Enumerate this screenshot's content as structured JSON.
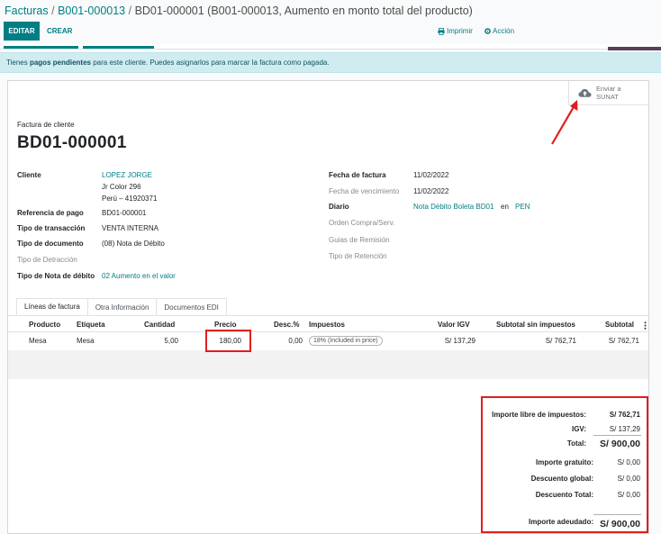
{
  "breadcrumb": {
    "item1": "Facturas",
    "sep1": " / ",
    "item2": "B001-000013",
    "sep2": " / ",
    "current": "BD01-000001 (B001-000013, Aumento en monto total del producto)"
  },
  "toolbar": {
    "edit": "EDITAR",
    "create": "CREAR",
    "print": "Imprimir",
    "action": "Acción"
  },
  "alert": {
    "prefix": "Tienes ",
    "bold": "pagos pendientes",
    "suffix": " para este cliente. Puedes asignarlos para marcar la factura como pagada."
  },
  "sunat": {
    "line1": "Enviar a",
    "line2": "SUNAT"
  },
  "invoice": {
    "subtitle": "Factura de cliente",
    "number": "BD01-000001"
  },
  "left": {
    "cliente_label": "Cliente",
    "cliente_name": "LOPEZ JORGE",
    "cliente_addr1": "Jr Color 296",
    "cliente_addr2": "Perú – 41920371",
    "ref_label": "Referencia de pago",
    "ref_value": "BD01-000001",
    "tipo_trans_label": "Tipo de transacción",
    "tipo_trans_value": "VENTA INTERNA",
    "tipo_doc_label": "Tipo de documento",
    "tipo_doc_value": "(08) Nota de Débito",
    "tipo_detr_label": "Tipo de Detracción",
    "tipo_nota_label": "Tipo de Nota de débito",
    "tipo_nota_value": "02 Aumento en el valor"
  },
  "right": {
    "fecha_label": "Fecha de factura",
    "fecha_value": "11/02/2022",
    "venc_label": "Fecha de vencimiento",
    "venc_value": "11/02/2022",
    "diario_label": "Diario",
    "diario_value": "Nota Débito Boleta BD01",
    "diario_en": "en",
    "diario_currency": "PEN",
    "orden_label": "Orden Compra/Serv.",
    "guias_label": "Guias de Remisión",
    "retencion_label": "Tipo de Retención"
  },
  "tabs": [
    "Líneas de factura",
    "Otra Información",
    "Documentos EDI"
  ],
  "table": {
    "headers": [
      "Producto",
      "Etiqueta",
      "Cantidad",
      "Precio",
      "Desc.%",
      "Impuestos",
      "Valor IGV",
      "Subtotal sin impuestos",
      "Subtotal"
    ],
    "row": {
      "producto": "Mesa",
      "etiqueta": "Mesa",
      "cantidad": "5,00",
      "precio": "180,00",
      "desc": "0,00",
      "impuestos": "18% (Included in price)",
      "valor_igv": "S/ 137,29",
      "subtotal_sin": "S/ 762,71",
      "subtotal": "S/ 762,71"
    }
  },
  "totals": {
    "libre_label": "Importe libre de impuestos:",
    "libre_value": "S/ 762,71",
    "igv_label": "IGV:",
    "igv_value": "S/ 137,29",
    "total_label": "Total:",
    "total_value": "S/ 900,00",
    "gratuito_label": "Importe gratuito:",
    "gratuito_value": "S/ 0,00",
    "desc_global_label": "Descuento global:",
    "desc_global_value": "S/ 0,00",
    "desc_total_label": "Descuento Total:",
    "desc_total_value": "S/ 0,00",
    "adeudado_label": "Importe adeudado:",
    "adeudado_value": "S/ 900,00"
  },
  "colors": {
    "brand": "#017e84",
    "highlight": "#e01e1e",
    "alert_bg": "#d1ecf1"
  },
  "icons": {
    "print": "printer-icon",
    "action": "gear-icon",
    "sunat": "cloud-upload-icon",
    "column_options": "kebab-icon"
  }
}
